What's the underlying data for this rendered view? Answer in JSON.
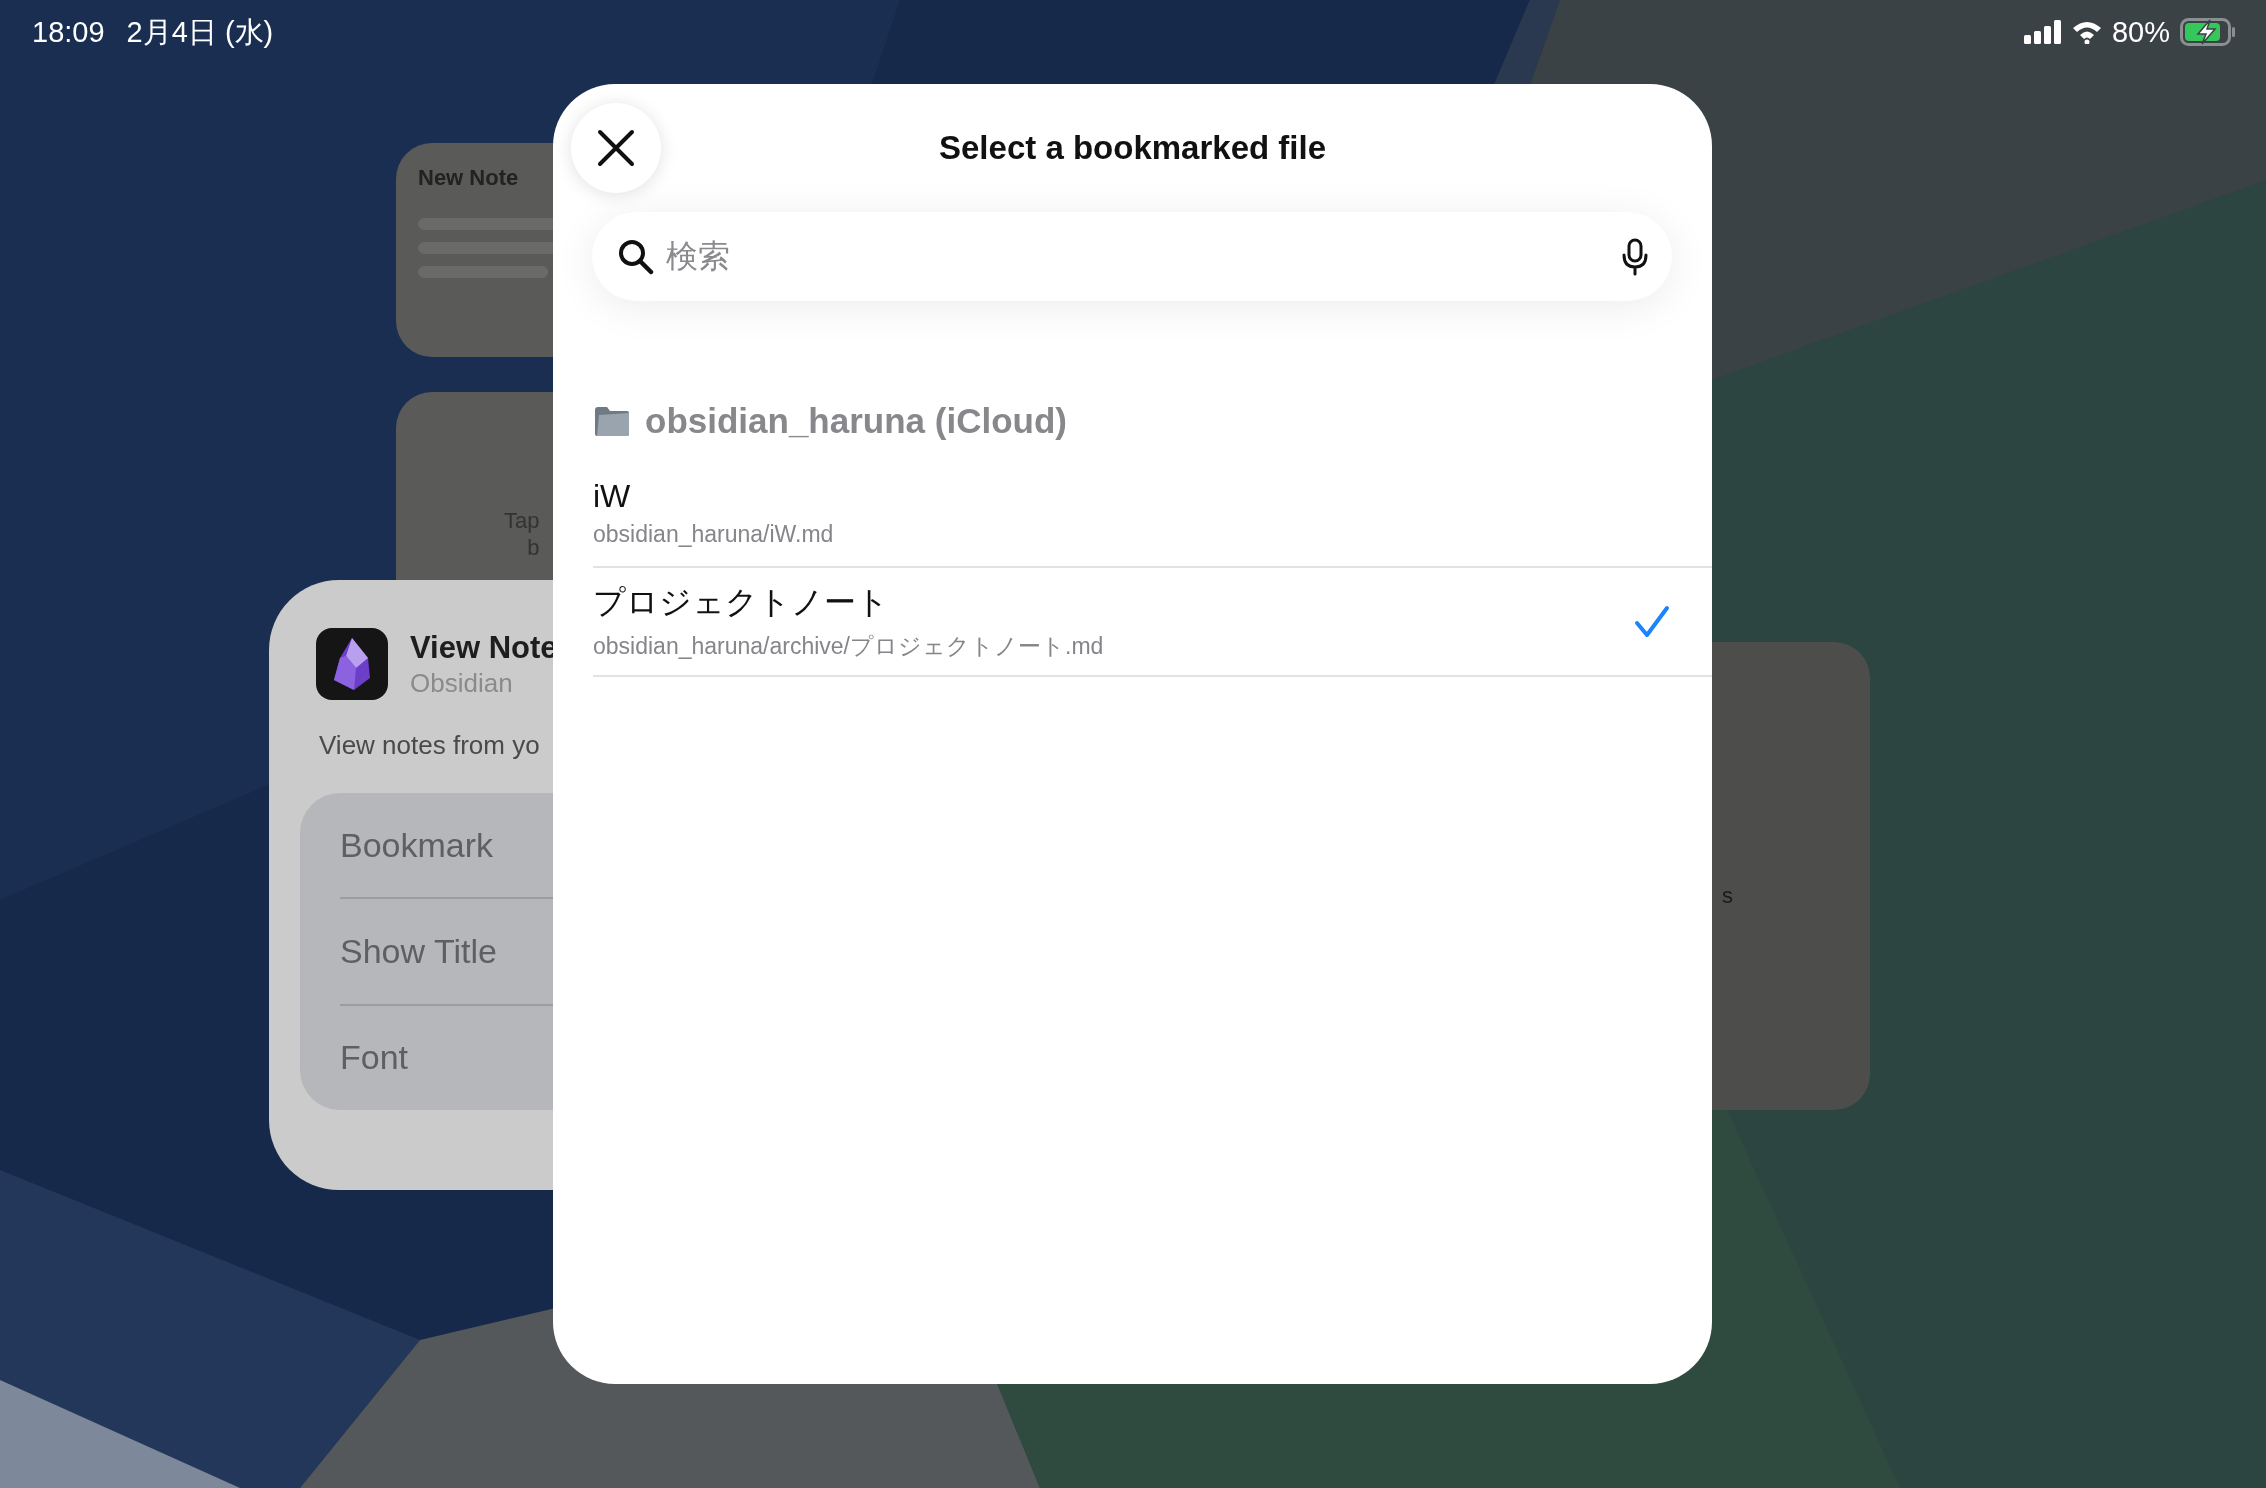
{
  "status_bar": {
    "time": "18:09",
    "date": "2月4日 (水)",
    "battery_text": "80%"
  },
  "home_widgets": {
    "new_note_card": {
      "title": "New Note"
    },
    "tap_card": {
      "lines": [
        "Tap",
        "b"
      ]
    },
    "config_card": {
      "title": "View Note",
      "app": "Obsidian",
      "description": "View notes from yo",
      "options": [
        "Bookmark",
        "Show Title",
        "Font"
      ]
    },
    "right_card": {
      "text": "s"
    }
  },
  "modal": {
    "title": "Select a bookmarked file",
    "search": {
      "placeholder": "検索"
    },
    "section": {
      "title": "obsidian_haruna (iCloud)",
      "items": [
        {
          "title": "iW",
          "path": "obsidian_haruna/iW.md",
          "selected": false
        },
        {
          "title": "プロジェクトノート",
          "path": "obsidian_haruna/archive/プロジェクトノート.md",
          "selected": true
        }
      ]
    }
  }
}
